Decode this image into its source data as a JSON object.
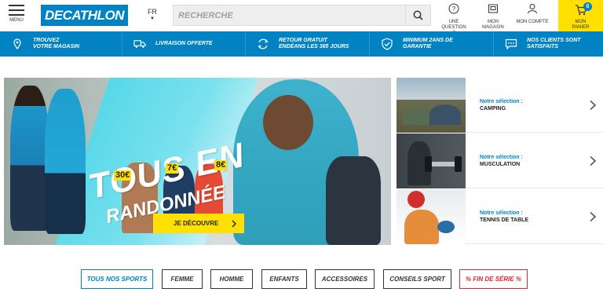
{
  "header": {
    "menu_label": "MENU",
    "logo_text": "DECATHLON",
    "language": "FR",
    "search_placeholder": "RECHERCHE",
    "question_label_1": "UNE",
    "question_label_2": "QUESTION ?",
    "store_label_1": "MON",
    "store_label_2": "MAGASIN",
    "account_label": "MON COMPTE",
    "cart_label_1": "MON",
    "cart_label_2": "PANIER",
    "cart_count": "0"
  },
  "benefits": [
    {
      "line1": "TROUVEZ",
      "line2": "VOTRE MAGASIN",
      "icon": "location-pin-icon"
    },
    {
      "line1": "LIVRAISON OFFERTE",
      "line2": "",
      "icon": "truck-icon"
    },
    {
      "line1": "RETOUR GRATUIT",
      "line2": "ENDÉANS LES 365 JOURS",
      "icon": "return-icon"
    },
    {
      "line1": "MINIMUM 2ANS DE",
      "line2": "GARANTIE",
      "icon": "shield-check-icon"
    },
    {
      "line1": "NOS CLIENTS SONT",
      "line2": "SATISFAITS",
      "icon": "chat-bubble-icon"
    }
  ],
  "hero": {
    "title_line1": "TOUS EN",
    "title_line2": "RANDONNÉE",
    "prices": [
      "30€",
      "7€",
      "8€"
    ],
    "cta_label": "JE DÉCOUVRE"
  },
  "selections": [
    {
      "prefix": "Notre sélection :",
      "category": "CAMPING"
    },
    {
      "prefix": "Notre sélection :",
      "category": "MUSCULATION"
    },
    {
      "prefix": "Notre sélection :",
      "category": "TENNIS DE TABLE"
    }
  ],
  "filters": [
    {
      "label": "TOUS NOS SPORTS",
      "color": "#0082c3"
    },
    {
      "label": "FEMME",
      "color": "#333333"
    },
    {
      "label": "HOMME",
      "color": "#333333"
    },
    {
      "label": "ENFANTS",
      "color": "#333333"
    },
    {
      "label": "ACCESSOIRES",
      "color": "#333333"
    },
    {
      "label": "CONSEILS SPORT",
      "color": "#333333"
    },
    {
      "label": "% FIN DE SÉRIE %",
      "color": "#e3262f"
    }
  ],
  "colors": {
    "brand_blue": "#0082c3",
    "accent_yellow": "#ffe000",
    "sale_red": "#e3262f"
  }
}
